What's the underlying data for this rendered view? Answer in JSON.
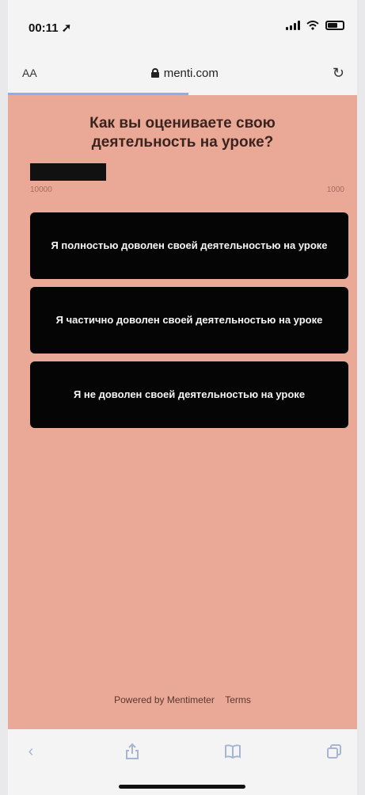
{
  "status_bar": {
    "time": "00:11",
    "location_arrow": "location-arrow-icon",
    "signal": "signal-bars-icon",
    "wifi": "wifi-icon",
    "battery": "battery-icon"
  },
  "browser": {
    "text_size_label": "AA",
    "url": "menti.com",
    "lock": "lock-icon",
    "reload": "reload-icon"
  },
  "poll": {
    "question": "Как вы оцениваете свою деятельность на уроке?",
    "scale_left": "10000",
    "scale_right": "1000",
    "options": [
      {
        "label": "Я полностью доволен своей деятельностью на уроке"
      },
      {
        "label": "Я частично доволен своей деятельностью на уроке"
      },
      {
        "label": "Я не доволен своей деятельностью на уроке"
      }
    ]
  },
  "footer": {
    "powered_by": "Powered by Mentimeter",
    "terms": "Terms"
  },
  "toolbar": {
    "back": "back-chevron-icon",
    "share": "share-icon",
    "bookmarks": "book-icon",
    "tabs": "tabs-icon"
  },
  "colors": {
    "background": "#e9a996",
    "option_bg": "#060506",
    "option_text": "#f5f5f5",
    "question_text": "#3b2420",
    "toolbar_icons": "#a8b5d2"
  }
}
